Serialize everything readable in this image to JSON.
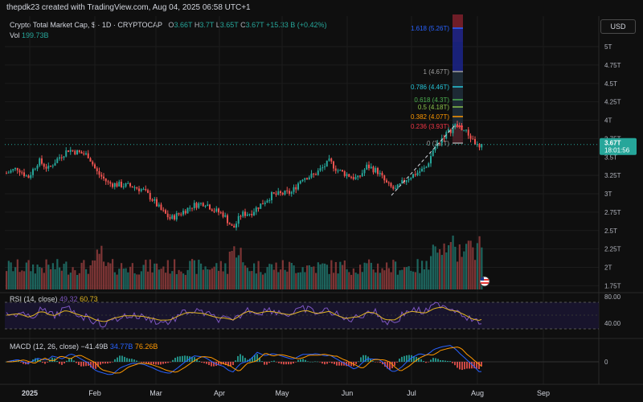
{
  "header": {
    "watermark": "thepdk23 created with TradingView.com, Aug 04, 2025 06:58 UTC+1"
  },
  "legend": {
    "symbol": "Crypto Total Market Cap, $ · 1D · CRYPTOCAP",
    "open_label": "O",
    "open": "3.66T",
    "high_label": "H",
    "high": "3.7T",
    "low_label": "L",
    "low": "3.65T",
    "close_label": "C",
    "close": "3.67T",
    "change": "+15.33 B (+0.42%)",
    "vol_label": "Vol",
    "vol": "199.73B"
  },
  "currency_button": "USD",
  "price_axis": {
    "ticks": [
      "5T",
      "4.75T",
      "4.5T",
      "4.25T",
      "4T",
      "3.75T",
      "3.5T",
      "3.25T",
      "3T",
      "2.75T",
      "2.5T",
      "2.25T",
      "2T",
      "1.75T"
    ],
    "current_price": "3.67T",
    "countdown": "18:01:56"
  },
  "fib_levels": [
    {
      "label": "1.618 (5.26T)",
      "color": "#2962ff"
    },
    {
      "label": "1 (4.67T)",
      "color": "#9e9e9e"
    },
    {
      "label": "0.786 (4.46T)",
      "color": "#26c6da"
    },
    {
      "label": "0.618 (4.3T)",
      "color": "#4caf50"
    },
    {
      "label": "0.5 (4.18T)",
      "color": "#8bc34a"
    },
    {
      "label": "0.382 (4.07T)",
      "color": "#ff9800"
    },
    {
      "label": "0.236 (3.93T)",
      "color": "#f23645"
    },
    {
      "label": "0 (3.7T)",
      "color": "#9e9e9e"
    }
  ],
  "rsi": {
    "title": "RSI (14, close)",
    "value1": "49.32",
    "value2": "60.73",
    "ticks": [
      "80.00",
      "40.00"
    ]
  },
  "macd": {
    "title": "MACD (12, 26, close)",
    "hist": "−41.49B",
    "macd_value": "34.77B",
    "signal_value": "76.26B",
    "ticks": [
      "0"
    ]
  },
  "time_axis": {
    "labels": [
      "2025",
      "Feb",
      "Mar",
      "Apr",
      "May",
      "Jun",
      "Jul",
      "Aug",
      "Sep"
    ]
  },
  "colors": {
    "up": "#26a69a",
    "down": "#ef5350",
    "background": "#0f0f0f"
  }
}
